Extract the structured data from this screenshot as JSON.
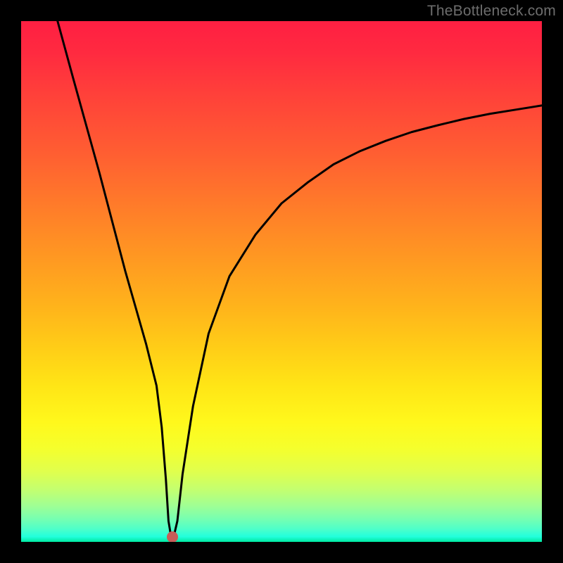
{
  "watermark": "TheBottleneck.com",
  "chart_data": {
    "type": "line",
    "title": "",
    "xlabel": "",
    "ylabel": "",
    "xlim": [
      0,
      100
    ],
    "ylim": [
      0,
      100
    ],
    "x": [
      7,
      10,
      15,
      20,
      22,
      24,
      26,
      27,
      27.8,
      28.3,
      28.8,
      29.3,
      30,
      31,
      33,
      36,
      40,
      45,
      50,
      55,
      60,
      65,
      70,
      75,
      80,
      85,
      90,
      95,
      100
    ],
    "y": [
      100,
      89,
      71,
      52,
      45,
      38,
      30,
      22,
      12,
      4,
      1,
      1,
      4,
      13,
      26,
      40,
      51,
      59,
      65,
      69,
      72.5,
      75,
      77,
      78.7,
      80,
      81.2,
      82.2,
      83,
      83.8
    ],
    "marker": {
      "x": 29,
      "y": 1
    },
    "gradient_stops": [
      {
        "offset": 0.0,
        "color": "#ff1f42"
      },
      {
        "offset": 0.06,
        "color": "#ff2a40"
      },
      {
        "offset": 0.15,
        "color": "#ff4339"
      },
      {
        "offset": 0.25,
        "color": "#ff5d32"
      },
      {
        "offset": 0.35,
        "color": "#ff7a2a"
      },
      {
        "offset": 0.45,
        "color": "#ff9722"
      },
      {
        "offset": 0.55,
        "color": "#ffb41b"
      },
      {
        "offset": 0.63,
        "color": "#ffce17"
      },
      {
        "offset": 0.7,
        "color": "#ffe516"
      },
      {
        "offset": 0.77,
        "color": "#fff81c"
      },
      {
        "offset": 0.82,
        "color": "#f5ff2c"
      },
      {
        "offset": 0.865,
        "color": "#e0ff4d"
      },
      {
        "offset": 0.9,
        "color": "#c3ff70"
      },
      {
        "offset": 0.93,
        "color": "#a0ff93"
      },
      {
        "offset": 0.955,
        "color": "#78ffb0"
      },
      {
        "offset": 0.975,
        "color": "#4effc9"
      },
      {
        "offset": 0.99,
        "color": "#22ffdc"
      },
      {
        "offset": 1.0,
        "color": "#00e8a0"
      }
    ]
  }
}
